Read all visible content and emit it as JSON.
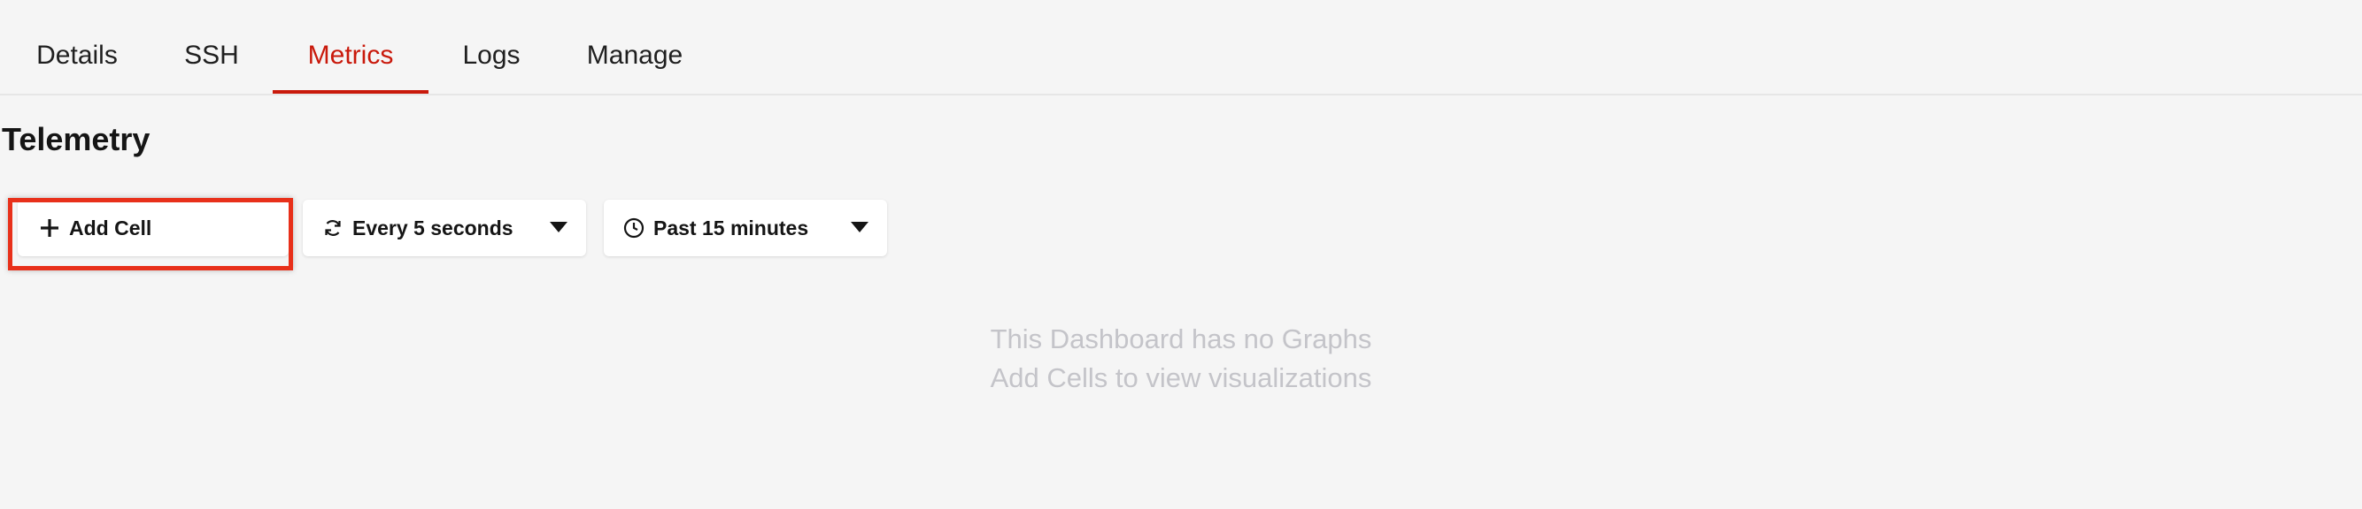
{
  "tabs": [
    {
      "label": "Details",
      "active": false
    },
    {
      "label": "SSH",
      "active": false
    },
    {
      "label": "Metrics",
      "active": true
    },
    {
      "label": "Logs",
      "active": false
    },
    {
      "label": "Manage",
      "active": false
    }
  ],
  "section_title": "Telemetry",
  "toolbar": {
    "add_cell_label": "Add Cell",
    "refresh_interval": "Every 5 seconds",
    "time_range": "Past 15 minutes"
  },
  "empty_state": {
    "line1": "This Dashboard has no Graphs",
    "line2": "Add Cells to view visualizations"
  },
  "icons": {
    "add": "plus-icon",
    "refresh": "refresh-icon",
    "clock": "clock-icon",
    "dropdown": "caret-down-icon"
  },
  "colors": {
    "accent": "#c9190b",
    "highlight_border": "#e8301a",
    "empty_text": "#c4c4c9"
  }
}
